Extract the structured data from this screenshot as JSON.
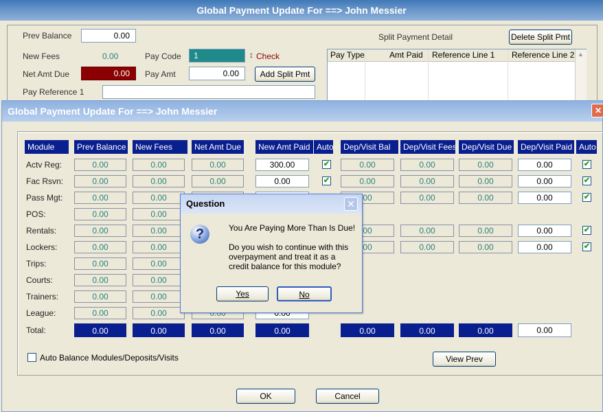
{
  "back_window": {
    "title": "Global Payment Update For ==> John Messier",
    "prev_balance_label": "Prev Balance",
    "prev_balance_value": "0.00",
    "new_fees_label": "New Fees",
    "new_fees_value": "0.00",
    "net_amt_due_label": "Net Amt Due",
    "net_amt_due_value": "0.00",
    "pay_code_label": "Pay Code",
    "pay_code_value": "1",
    "pay_code_desc": "Check",
    "pay_amt_label": "Pay Amt",
    "pay_amt_value": "0.00",
    "add_split_label": "Add Split Pmt",
    "pay_ref_label": "Pay Reference 1",
    "split_detail_label": "Split Payment Detail",
    "delete_split_label": "Delete Split Pmt",
    "split_columns": [
      "Pay Type",
      "Amt Paid",
      "Reference Line 1",
      "Reference Line 2"
    ]
  },
  "front_window": {
    "title": "Global Payment Update For ==> John Messier",
    "columns": [
      "Module",
      "Prev Balance",
      "New Fees",
      "Net Amt Due",
      "New Amt Paid",
      "Auto",
      "Dep/Visit Bal",
      "Dep/Visit Fees",
      "Dep/Visit Due",
      "Dep/Visit Paid",
      "Auto"
    ],
    "rows": [
      {
        "label": "Actv Reg:",
        "prev": "0.00",
        "fees": "0.00",
        "due": "0.00",
        "paid": "300.00",
        "dbal": "0.00",
        "dfees": "0.00",
        "ddue": "0.00",
        "dpaid": "0.00"
      },
      {
        "label": "Fac Rsvn:",
        "prev": "0.00",
        "fees": "0.00",
        "due": "0.00",
        "paid": "0.00",
        "dbal": "0.00",
        "dfees": "0.00",
        "ddue": "0.00",
        "dpaid": "0.00"
      },
      {
        "label": "Pass Mgt:",
        "prev": "0.00",
        "fees": "0.00",
        "due": "",
        "paid": "",
        "dbal": "00",
        "dfees": "0.00",
        "ddue": "0.00",
        "dpaid": "0.00"
      },
      {
        "label": "POS:",
        "prev": "0.00",
        "fees": "0.00"
      },
      {
        "label": "Rentals:",
        "prev": "0.00",
        "fees": "0.00",
        "dbal": "00",
        "dfees": "0.00",
        "ddue": "0.00",
        "dpaid": "0.00"
      },
      {
        "label": "Lockers:",
        "prev": "0.00",
        "fees": "0.00",
        "dbal": "00",
        "dfees": "0.00",
        "ddue": "0.00",
        "dpaid": "0.00"
      },
      {
        "label": "Trips:",
        "prev": "0.00",
        "fees": "0.00"
      },
      {
        "label": "Courts:",
        "prev": "0.00",
        "fees": "0.00"
      },
      {
        "label": "Trainers:",
        "prev": "0.00",
        "fees": "0.00"
      },
      {
        "label": "League:",
        "prev": "0.00",
        "fees": "0.00",
        "due": "0.00",
        "paid": "0.00"
      }
    ],
    "total_label": "Total:",
    "totals": {
      "prev": "0.00",
      "fees": "0.00",
      "due": "0.00",
      "paid": "0.00",
      "dbal": "0.00",
      "dfees": "0.00",
      "ddue": "0.00",
      "dpaid": "0.00"
    },
    "auto_balance_label": "Auto Balance Modules/Deposits/Visits",
    "view_prev_label": "View Prev",
    "ok_label": "OK",
    "cancel_label": "Cancel"
  },
  "question": {
    "title": "Question",
    "line1": "You Are Paying More Than Is Due!",
    "line2": "Do you wish to continue with this",
    "line3": "overpayment and treat it as a",
    "line4": "credit balance for this module?",
    "yes_label": "Yes",
    "no_label": "No"
  },
  "colors": {
    "header_blue": "#0a1f8f",
    "net_due_red": "#8b0000",
    "pay_code_teal": "#1f8a8a"
  }
}
